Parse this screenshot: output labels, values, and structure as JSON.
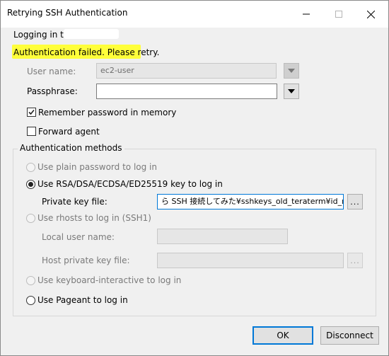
{
  "window": {
    "title": "Retrying SSH Authentication",
    "controls": {
      "minimize": "minimize",
      "maximize": "maximize",
      "close": "close"
    }
  },
  "status": {
    "logging_in": "Logging in to",
    "message": "Authentication failed. Please retry."
  },
  "form": {
    "user_name_label": "User name:",
    "user_name_value": "ec2-user",
    "passphrase_label": "Passphrase:",
    "passphrase_value": "",
    "remember_label": "Remember password in memory",
    "remember_checked": true,
    "forward_agent_label": "Forward agent",
    "forward_agent_checked": false
  },
  "auth_methods": {
    "legend": "Authentication methods",
    "plain_password_label": "Use plain password to log in",
    "rsa_label": "Use RSA/DSA/ECDSA/ED25519 key to log in",
    "private_key_label": "Private key file:",
    "private_key_value": "ら SSH 接続してみた¥sshkeys_old_teraterm¥id_rsa",
    "browse_label": "...",
    "rhosts_label": "Use rhosts to log in (SSH1)",
    "local_user_label": "Local user name:",
    "host_private_key_label": "Host private key file:",
    "keyboard_interactive_label": "Use keyboard-interactive to log in",
    "pageant_label": "Use Pageant to log in",
    "selected": "rsa"
  },
  "buttons": {
    "ok": "OK",
    "disconnect": "Disconnect"
  },
  "colors": {
    "highlight": "#ffff3a",
    "focus_border": "#0078d7"
  }
}
